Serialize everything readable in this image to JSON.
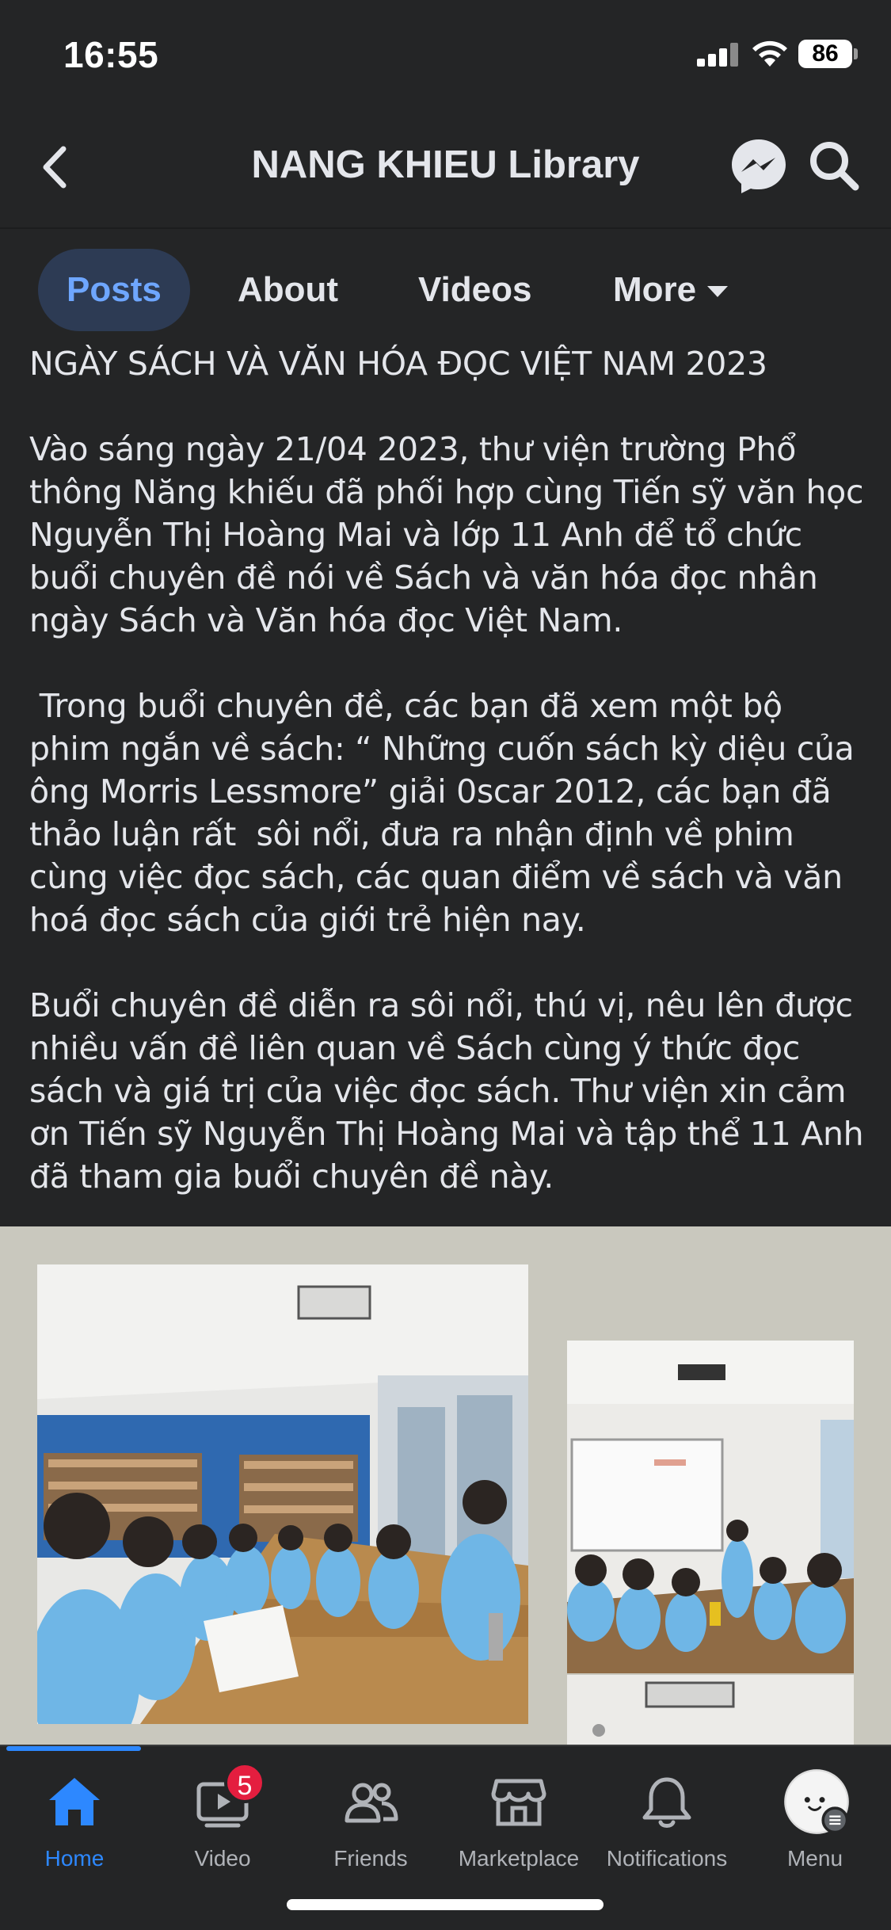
{
  "status_bar": {
    "time": "16:55",
    "battery": "86"
  },
  "header": {
    "title": "NANG KHIEU Library"
  },
  "tabs": [
    {
      "label": "Posts"
    },
    {
      "label": "About"
    },
    {
      "label": "Videos"
    },
    {
      "label": "More"
    }
  ],
  "post": {
    "title": "NGÀY SÁCH VÀ VĂN HÓA ĐỌC VIỆT NAM 2023",
    "paragraphs": [
      "Vào sáng ngày 21/04 2023, thư viện trường Phổ thông Năng khiếu đã phối hợp cùng Tiến sỹ văn học Nguyễn Thị Hoàng Mai và lớp 11 Anh để tổ chức buổi chuyên đề nói về Sách và văn hóa đọc nhân ngày Sách và Văn hóa đọc Việt Nam.",
      " Trong buổi chuyên đề, các bạn đã xem một bộ phim ngắn về sách: “ Những cuốn sách kỳ diệu của ông Morris Lessmore” giải 0scar 2012, các bạn đã thảo luận rất  sôi nổi, đưa ra nhận định về phim cùng việc đọc sách, các quan điểm về sách và văn hoá đọc sách của giới trẻ hiện nay.",
      "Buổi chuyên đề diễn ra sôi nổi, thú vị, nêu lên được nhiều vấn đề liên quan về Sách cùng ý thức đọc sách và giá trị của việc đọc sách. Thư viện xin cảm ơn Tiến sỹ Nguyễn Thị Hoàng Mai và tập thể 11 Anh đã tham gia buổi chuyên đề này."
    ]
  },
  "nav": [
    {
      "label": "Home",
      "icon": "home-icon"
    },
    {
      "label": "Video",
      "icon": "video-icon",
      "badge": "5"
    },
    {
      "label": "Friends",
      "icon": "friends-icon"
    },
    {
      "label": "Marketplace",
      "icon": "marketplace-icon"
    },
    {
      "label": "Notifications",
      "icon": "bell-icon"
    },
    {
      "label": "Menu",
      "icon": "avatar"
    }
  ],
  "colors": {
    "accent": "#2d88ff",
    "background": "#242526",
    "badge": "#e41e3f",
    "photo_backdrop": "#c9c8be"
  }
}
